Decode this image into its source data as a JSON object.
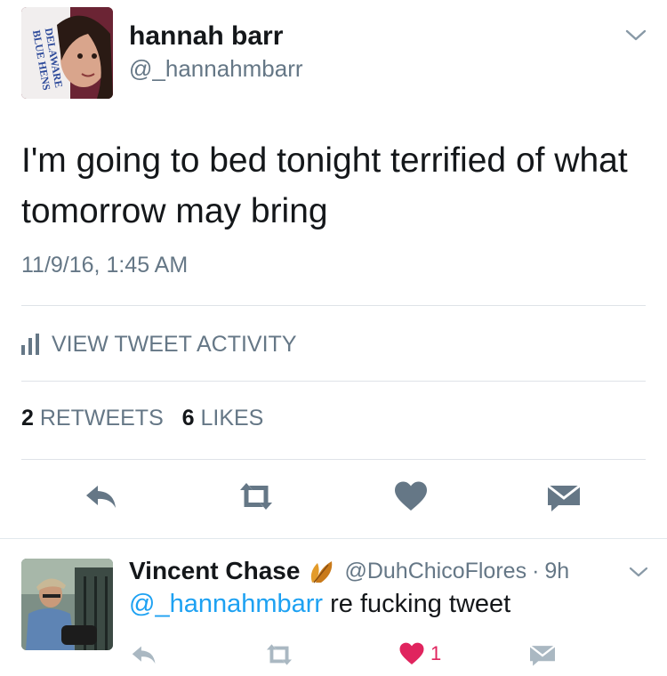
{
  "main_tweet": {
    "display_name": "hannah barr",
    "handle": "@_hannahmbarr",
    "avatar_text": "DELAWARE BLUE HENS",
    "text": "I'm going to bed tonight terrified of what tomorrow may bring",
    "timestamp": "11/9/16, 1:45 AM",
    "activity_label": "VIEW TWEET ACTIVITY",
    "retweet_count": "2",
    "retweet_label": "RETWEETS",
    "like_count": "6",
    "like_label": "LIKES"
  },
  "reply": {
    "display_name": "Vincent Chase",
    "name_emoji": "leaves-emoji",
    "handle": "@DuhChicoFlores",
    "separator": "·",
    "time": "9h",
    "mention": "@_hannahmbarr",
    "text": " re fucking tweet",
    "like_count": "1"
  },
  "colors": {
    "text": "#14171a",
    "secondary": "#657786",
    "icon": "#657786",
    "link": "#1da1f2",
    "like": "#e0245e",
    "divider": "#e1e8ed"
  },
  "icons": [
    "chevron-down-icon",
    "bar-chart-icon",
    "reply-icon",
    "retweet-icon",
    "heart-icon",
    "direct-message-icon"
  ]
}
